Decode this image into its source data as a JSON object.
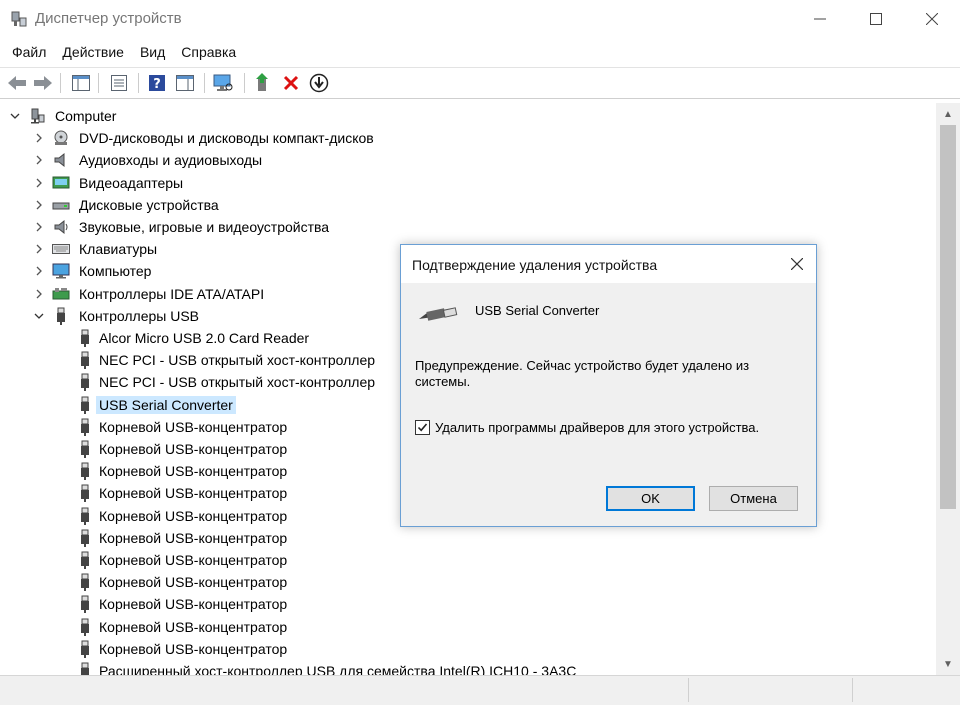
{
  "window": {
    "title": "Диспетчер устройств",
    "icon": "device-manager-icon"
  },
  "menu": [
    "Файл",
    "Действие",
    "Вид",
    "Справка"
  ],
  "toolbar": {
    "icons": [
      "back-arrow-icon",
      "forward-arrow-icon",
      "console-tree-icon",
      "properties-icon",
      "help-icon",
      "action-pane-icon",
      "scan-hardware-icon",
      "update-driver-icon",
      "uninstall-device-icon",
      "download-icon"
    ]
  },
  "tree": {
    "root": "Computer",
    "categories": [
      {
        "label": "DVD-дисководы и дисководы компакт-дисков",
        "icon": "dvd-drive-icon"
      },
      {
        "label": "Аудиовходы и аудиовыходы",
        "icon": "speaker-icon"
      },
      {
        "label": "Видеоадаптеры",
        "icon": "display-adapter-icon"
      },
      {
        "label": "Дисковые устройства",
        "icon": "disk-drive-icon"
      },
      {
        "label": "Звуковые, игровые и видеоустройства",
        "icon": "sound-device-icon"
      },
      {
        "label": "Клавиатуры",
        "icon": "keyboard-icon"
      },
      {
        "label": "Компьютер",
        "icon": "monitor-icon"
      },
      {
        "label": "Контроллеры IDE ATA/ATAPI",
        "icon": "ide-controller-icon"
      },
      {
        "label": "Контроллеры USB",
        "icon": "usb-icon",
        "expanded": true
      }
    ],
    "usb_children": [
      "Alcor Micro USB 2.0 Card Reader",
      "NEC PCI - USB открытый хост-контроллер",
      "NEC PCI - USB открытый хост-контроллер",
      "USB Serial Converter",
      "Корневой USB-концентратор",
      "Корневой USB-концентратор",
      "Корневой USB-концентратор",
      "Корневой USB-концентратор",
      "Корневой USB-концентратор",
      "Корневой USB-концентратор",
      "Корневой USB-концентратор",
      "Корневой USB-концентратор",
      "Корневой USB-концентратор",
      "Корневой USB-концентратор",
      "Корневой USB-концентратор",
      "Расширенный хост-контроллер USB для семейства Intel(R) ICH10 - 3A3C"
    ],
    "selected": "USB Serial Converter"
  },
  "dialog": {
    "title": "Подтверждение удаления устройства",
    "device_name": "USB Serial Converter",
    "warning": "Предупреждение. Сейчас устройство будет удалено из системы.",
    "checkbox_label": "Удалить программы драйверов для этого устройства.",
    "checkbox_checked": true,
    "ok_label": "OK",
    "cancel_label": "Отмена"
  },
  "colors": {
    "selection": "#cce8ff",
    "dialog_border": "#6a9fd4",
    "default_button_border": "#0078d7"
  }
}
